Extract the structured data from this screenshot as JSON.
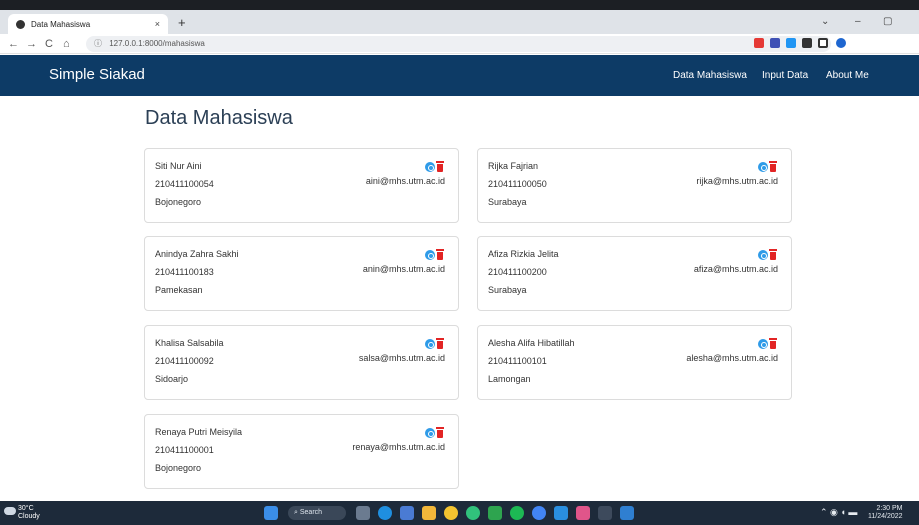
{
  "browser": {
    "tab_title": "Data Mahasiswa",
    "tab_close": "×",
    "new_tab": "+",
    "url": "127.0.0.1:8000/mahasiswa",
    "nav": {
      "back": "←",
      "forward": "→",
      "reload": "C",
      "home": "⌂"
    },
    "window_controls": {
      "chevron": "⌄",
      "minimize": "–",
      "maximize": "▢"
    }
  },
  "app": {
    "brand": "Simple Siakad",
    "nav": [
      "Data Mahasiswa",
      "Input Data",
      "About Me"
    ]
  },
  "page": {
    "title": "Data Mahasiswa",
    "students": [
      {
        "name": "Siti Nur Aini",
        "nim": "210411100054",
        "city": "Bojonegoro",
        "email": "aini@mhs.utm.ac.id"
      },
      {
        "name": "Rijka Fajrian",
        "nim": "210411100050",
        "city": "Surabaya",
        "email": "rijka@mhs.utm.ac.id"
      },
      {
        "name": "Anindya Zahra Sakhi",
        "nim": "210411100183",
        "city": "Pamekasan",
        "email": "anin@mhs.utm.ac.id"
      },
      {
        "name": "Afiza Rizkia Jelita",
        "nim": "210411100200",
        "city": "Surabaya",
        "email": "afiza@mhs.utm.ac.id"
      },
      {
        "name": "Khalisa Salsabila",
        "nim": "210411100092",
        "city": "Sidoarjo",
        "email": "salsa@mhs.utm.ac.id"
      },
      {
        "name": "Alesha Alifa Hibatillah",
        "nim": "210411100101",
        "city": "Lamongan",
        "email": "alesha@mhs.utm.ac.id"
      },
      {
        "name": "Renaya Putri Meisyila",
        "nim": "210411100001",
        "city": "Bojonegoro",
        "email": "renaya@mhs.utm.ac.id"
      }
    ]
  },
  "taskbar": {
    "weather_temp": "30°C",
    "weather_desc": "Cloudy",
    "search_label": "Search",
    "time": "2:30 PM",
    "date": "11/24/2022"
  },
  "colors": {
    "navbar": "#0d3b66",
    "edit_icon": "#2f9be8",
    "delete_icon": "#e22424"
  }
}
